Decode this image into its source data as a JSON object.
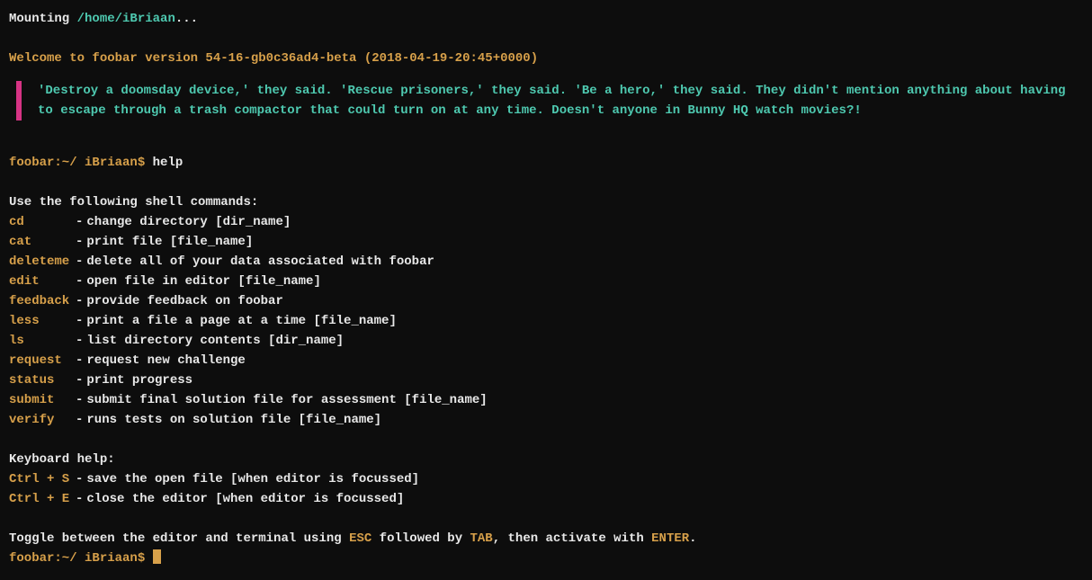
{
  "mount": {
    "prefix": "Mounting ",
    "path": "/home/iBriaan",
    "suffix": "..."
  },
  "welcome": "Welcome to foobar version 54-16-gb0c36ad4-beta (2018-04-19-20:45+0000)",
  "quote": "'Destroy a doomsday device,' they said. 'Rescue prisoners,' they said. 'Be a hero,' they said. They didn't mention anything about having to escape through a trash compactor that could turn on at any time. Doesn't anyone in Bunny HQ watch movies?!",
  "prompt1": {
    "host": "foobar:~/ iBriaan$ ",
    "cmd": "help"
  },
  "help": {
    "intro": "Use the following shell commands:",
    "commands": [
      {
        "name": "cd",
        "desc": "change directory [dir_name]"
      },
      {
        "name": "cat",
        "desc": "print file [file_name]"
      },
      {
        "name": "deleteme",
        "desc": "delete all of your data associated with foobar"
      },
      {
        "name": "edit",
        "desc": "open file in editor [file_name]"
      },
      {
        "name": "feedback",
        "desc": "provide feedback on foobar"
      },
      {
        "name": "less",
        "desc": "print a file a page at a time [file_name]"
      },
      {
        "name": "ls",
        "desc": "list directory contents [dir_name]"
      },
      {
        "name": "request",
        "desc": "request new challenge"
      },
      {
        "name": "status",
        "desc": "print progress"
      },
      {
        "name": "submit",
        "desc": "submit final solution file for assessment [file_name]"
      },
      {
        "name": "verify",
        "desc": "runs tests on solution file [file_name]"
      }
    ],
    "kbd_intro": "Keyboard help:",
    "kbd": [
      {
        "name": "Ctrl + S",
        "desc": "save the open file [when editor is focussed]"
      },
      {
        "name": "Ctrl + E",
        "desc": "close the editor [when editor is focussed]"
      }
    ],
    "toggle": {
      "p1": "Toggle between the editor and terminal using ",
      "k1": "ESC",
      "p2": " followed by ",
      "k2": "TAB",
      "p3": ", then activate with ",
      "k3": "ENTER",
      "p4": "."
    }
  },
  "prompt2": {
    "host": "foobar:~/ iBriaan$ "
  }
}
